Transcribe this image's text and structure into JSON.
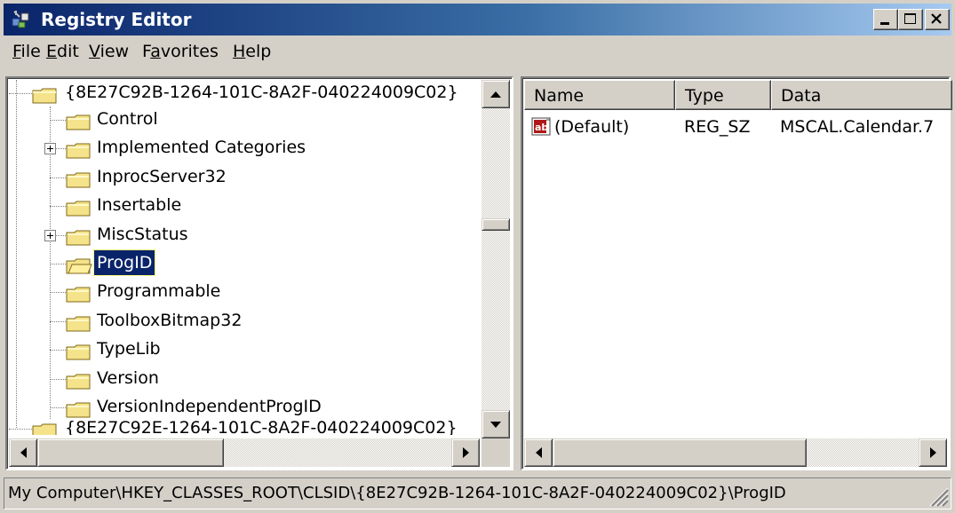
{
  "window": {
    "title": "Registry Editor",
    "icon": "registry-editor-icon"
  },
  "menu": [
    {
      "label": "File",
      "mnemonic_index": 0
    },
    {
      "label": "Edit",
      "mnemonic_index": 0
    },
    {
      "label": "View",
      "mnemonic_index": 0
    },
    {
      "label": "Favorites",
      "mnemonic_index": 1
    },
    {
      "label": "Help",
      "mnemonic_index": 0
    }
  ],
  "tree": {
    "root": "{8E27C92B-1264-101C-8A2F-040224009C02}",
    "children": [
      {
        "label": "Control",
        "expandable": false
      },
      {
        "label": "Implemented Categories",
        "expandable": true
      },
      {
        "label": "InprocServer32",
        "expandable": false
      },
      {
        "label": "Insertable",
        "expandable": false
      },
      {
        "label": "MiscStatus",
        "expandable": true
      },
      {
        "label": "ProgID",
        "expandable": false,
        "selected": true
      },
      {
        "label": "Programmable",
        "expandable": false
      },
      {
        "label": "ToolboxBitmap32",
        "expandable": false
      },
      {
        "label": "TypeLib",
        "expandable": false
      },
      {
        "label": "Version",
        "expandable": false
      },
      {
        "label": "VersionIndependentProgID",
        "expandable": false
      }
    ],
    "next_sibling": "{8E27C92E-1264-101C-8A2F-040224009C02}"
  },
  "list": {
    "columns": [
      "Name",
      "Type",
      "Data"
    ],
    "rows": [
      {
        "name": "(Default)",
        "type": "REG_SZ",
        "data": "MSCAL.Calendar.7",
        "icon": "string-value-icon"
      }
    ]
  },
  "status": {
    "path": "My Computer\\HKEY_CLASSES_ROOT\\CLSID\\{8E27C92B-1264-101C-8A2F-040224009C02}\\ProgID"
  },
  "colors": {
    "titlebar_start": "#0a246a",
    "titlebar_end": "#a6caf0",
    "selection": "#0a246a",
    "face": "#d4d0c8"
  }
}
